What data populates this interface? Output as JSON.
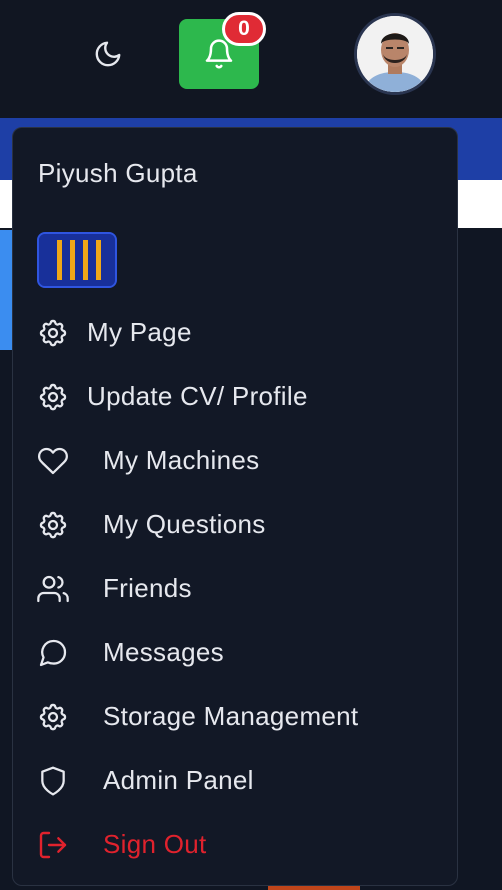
{
  "header": {
    "notifications_count": "0",
    "theme_toggle_icon": "moon-icon",
    "notification_icon": "bell-icon",
    "avatar_label": "user-avatar",
    "colors": {
      "bell_bg": "#2db84d",
      "badge_bg": "#e02b35",
      "header_bg": "#111622",
      "strip_blue": "#1e3fa6"
    }
  },
  "dropdown": {
    "user_name": "Piyush Gupta",
    "logo_icon": "brand-logo-icon",
    "items": [
      {
        "label": "My Page",
        "icon": "gear-icon"
      },
      {
        "label": "Update CV/ Profile",
        "icon": "gear-icon"
      },
      {
        "label": "My Machines",
        "icon": "heart-icon"
      },
      {
        "label": "My Questions",
        "icon": "gear-icon"
      },
      {
        "label": "Friends",
        "icon": "users-icon"
      },
      {
        "label": "Messages",
        "icon": "message-circle-icon"
      },
      {
        "label": "Storage Management",
        "icon": "gear-icon"
      },
      {
        "label": "Admin Panel",
        "icon": "shield-icon"
      },
      {
        "label": "Sign Out",
        "icon": "sign-out-icon"
      }
    ],
    "colors": {
      "text": "#e6e8ee",
      "danger": "#e0222d",
      "bg": "#121826"
    }
  }
}
